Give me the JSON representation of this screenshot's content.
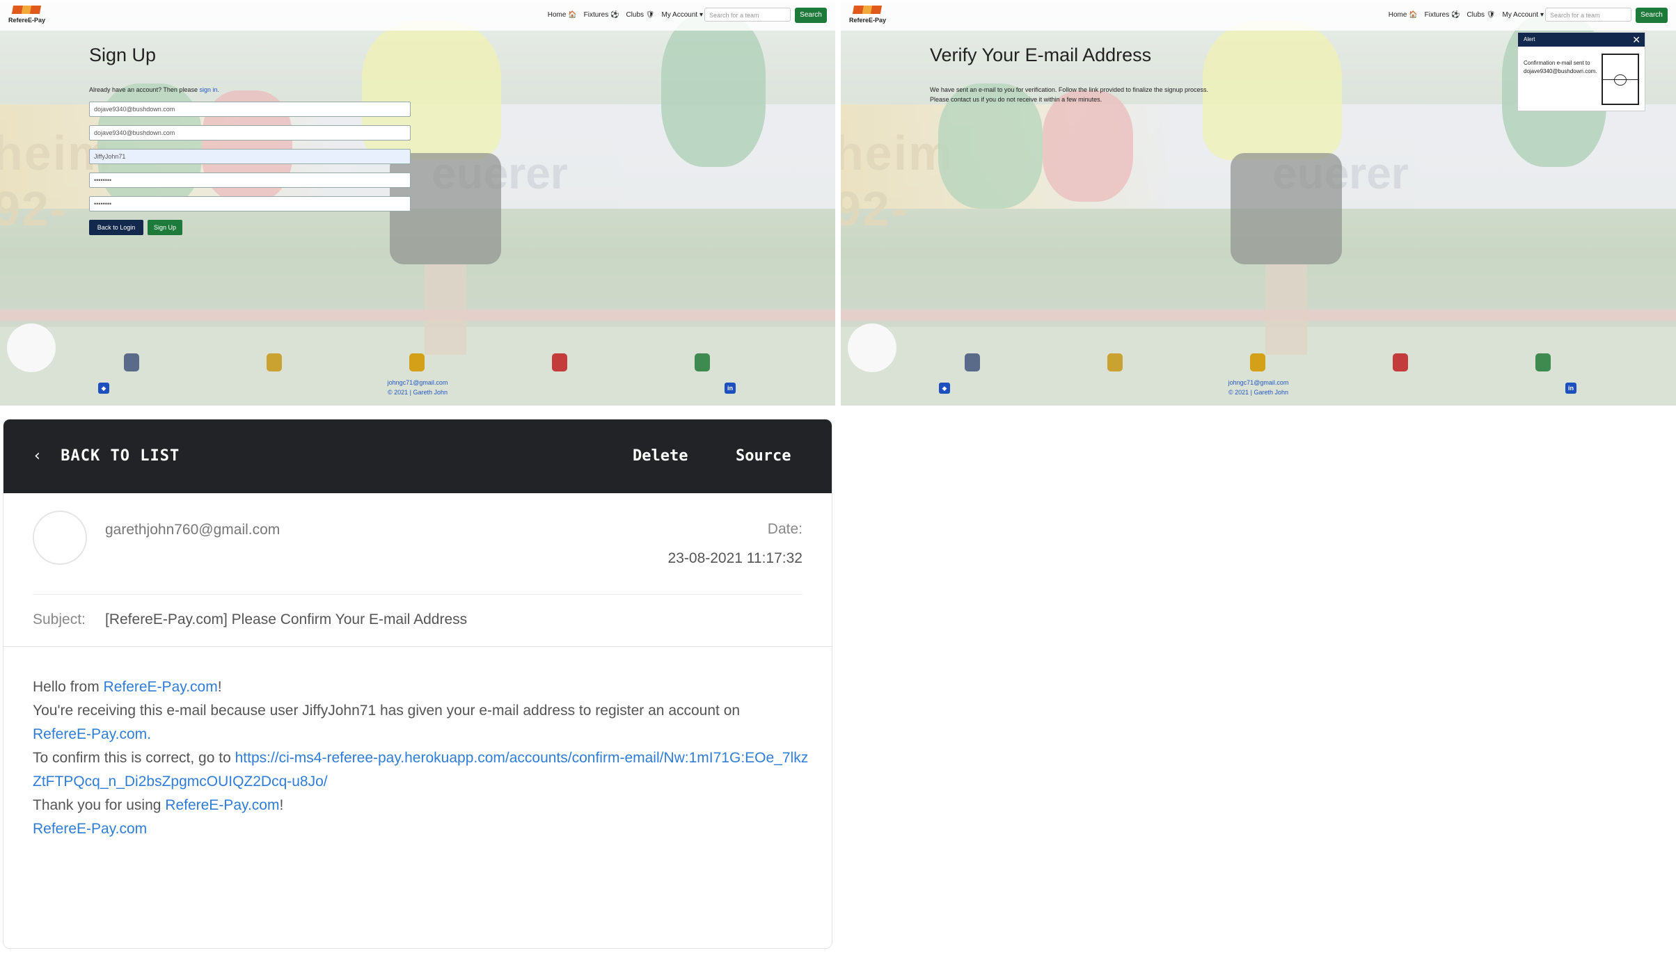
{
  "site": {
    "logo_text": "RefereE-Pay",
    "nav": {
      "home": "Home 🏠",
      "fixtures": "Fixtures ⚽",
      "clubs": "Clubs 🛡",
      "account": "My Account ▾",
      "search_placeholder": "Search for a team",
      "search_button": "Search"
    },
    "footer": {
      "email": "johngc71@gmail.com",
      "copyright": "© 2021 | Gareth John"
    }
  },
  "signup": {
    "title": "Sign Up",
    "have_account": "Already have an account? Then please",
    "sign_in_link": "sign in.",
    "fields": {
      "email": "dojave9340@bushdown.com",
      "email_again": "dojave9340@bushdown.com",
      "username": "JiffyJohn71",
      "password": "••••••••",
      "password_again": "••••••••"
    },
    "back_button": "Back to Login",
    "signup_button": "Sign Up"
  },
  "verify": {
    "title": "Verify Your E-mail Address",
    "line1": "We have sent an e-mail to you for verification. Follow the link provided to finalize the signup process.",
    "line2": "Please contact us if you do not receive it within a few minutes.",
    "alert_title": "Alert",
    "alert_close": "✕",
    "alert_text": "Confirmation e-mail sent to dojave9340@bushdown.com."
  },
  "email": {
    "back": "BACK TO LIST",
    "delete": "Delete",
    "source": "Source",
    "sender": "garethjohn760@gmail.com",
    "date_label": "Date:",
    "date_value": "23-08-2021 11:17:32",
    "subject_label": "Subject:",
    "subject_value": "[RefereE-Pay.com] Please Confirm Your E-mail Address",
    "hello": "Hello from ",
    "site_link": "RefereE-Pay.com",
    "excl": "!",
    "receiving": "You're receiving this e-mail because user JiffyJohn71 has given your e-mail address to register an account on",
    "period": ".",
    "confirm_text": "To confirm this is correct, go to ",
    "confirm_link": "https://ci-ms4-referee-pay.herokuapp.com/accounts/confirm-email/Nw:1mI71G:EOe_7lkzZtFTPQcq_n_Di2bsZpgmcOUIQZ2Dcq-u8Jo/",
    "thanks": "Thank you for using "
  },
  "colors": {
    "nav_button": "#1e7a3a",
    "dark_button": "#13284d",
    "email_header": "#212327",
    "link": "#2f7dd6"
  }
}
